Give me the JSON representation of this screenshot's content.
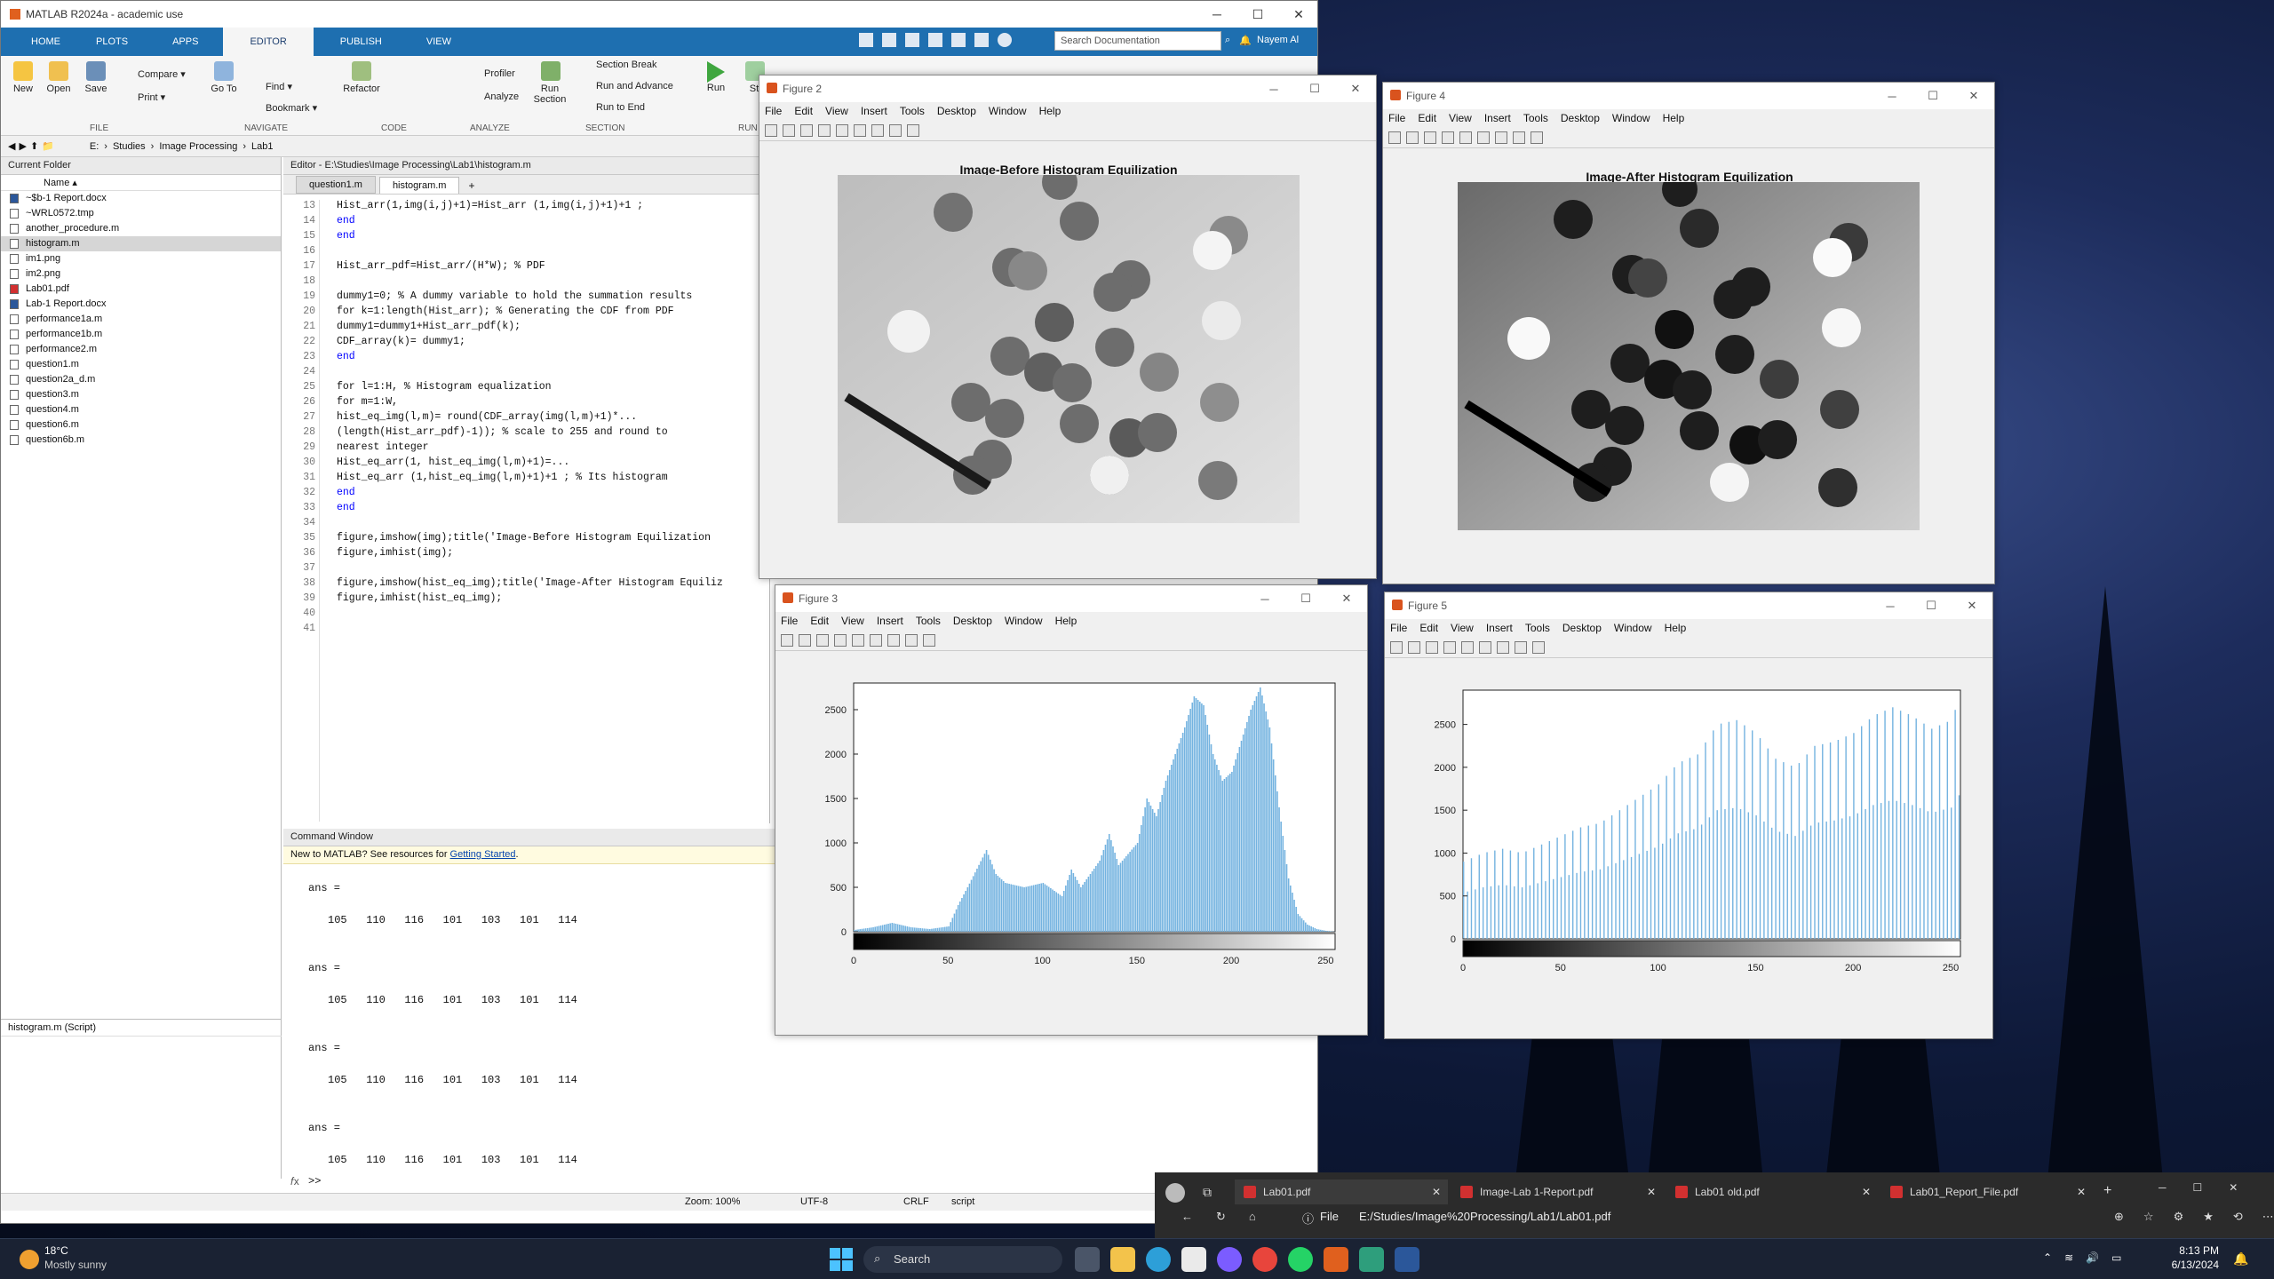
{
  "matlab": {
    "title": "MATLAB R2024a - academic use",
    "tabs": [
      "HOME",
      "PLOTS",
      "APPS",
      "EDITOR",
      "PUBLISH",
      "VIEW"
    ],
    "active_tab": "EDITOR",
    "search_placeholder": "Search Documentation",
    "user": "Nayem Al",
    "ribbon": {
      "new": "New",
      "open": "Open",
      "save": "Save",
      "compare": "Compare",
      "print": "Print",
      "goto": "Go To",
      "find": "Find",
      "bookmark": "Bookmark",
      "refactor": "Refactor",
      "profiler": "Profiler",
      "analyze": "Analyze",
      "run_section": "Run Section",
      "section_break": "Section Break",
      "run_advance": "Run and Advance",
      "run_end": "Run to End",
      "run": "Run",
      "step": "St",
      "groups": {
        "file": "FILE",
        "navigate": "NAVIGATE",
        "code": "CODE",
        "analyze": "ANALYZE",
        "section": "SECTION",
        "run": "RUN"
      }
    },
    "address": [
      "E:",
      "Studies",
      "Image Processing",
      "Lab1"
    ],
    "current_folder": {
      "title": "Current Folder",
      "name_header": "Name",
      "files": [
        "~$b-1 Report.docx",
        "~WRL0572.tmp",
        "another_procedure.m",
        "histogram.m",
        "im1.png",
        "im2.png",
        "Lab01.pdf",
        "Lab-1 Report.docx",
        "performance1a.m",
        "performance1b.m",
        "performance2.m",
        "question1.m",
        "question2a_d.m",
        "question3.m",
        "question4.m",
        "question6.m",
        "question6b.m"
      ],
      "selected": "histogram.m",
      "details": "histogram.m  (Script)"
    },
    "editor": {
      "title": "Editor - E:\\Studies\\Image Processing\\Lab1\\histogram.m",
      "tabs": [
        "question1.m",
        "histogram.m"
      ],
      "lines": [
        {
          "n": "13",
          "t": "Hist_arr(1,img(i,j)+1)=Hist_arr (1,img(i,j)+1)+1 ;"
        },
        {
          "n": "14",
          "t": "end",
          "c": "kw"
        },
        {
          "n": "15",
          "t": "end",
          "c": "kw"
        },
        {
          "n": "16",
          "t": ""
        },
        {
          "n": "17",
          "t": "Hist_arr_pdf=Hist_arr/(H*W); % PDF"
        },
        {
          "n": "18",
          "t": ""
        },
        {
          "n": "19",
          "t": "dummy1=0; % A dummy variable to hold the summation results"
        },
        {
          "n": "20",
          "t": "for k=1:length(Hist_arr); % Generating the CDF from PDF"
        },
        {
          "n": "21",
          "t": "dummy1=dummy1+Hist_arr_pdf(k);"
        },
        {
          "n": "22",
          "t": "CDF_array(k)= dummy1;"
        },
        {
          "n": "23",
          "t": "end",
          "c": "kw"
        },
        {
          "n": "24",
          "t": ""
        },
        {
          "n": "25",
          "t": "for l=1:H, % Histogram equalization"
        },
        {
          "n": "26",
          "t": "for m=1:W,"
        },
        {
          "n": "27",
          "t": "hist_eq_img(l,m)= round(CDF_array(img(l,m)+1)*..."
        },
        {
          "n": "28",
          "t": "(length(Hist_arr_pdf)-1)); % scale to 255 and round to"
        },
        {
          "n": "29",
          "t": "nearest integer"
        },
        {
          "n": "30",
          "t": "Hist_eq_arr(1, hist_eq_img(l,m)+1)=..."
        },
        {
          "n": "31",
          "t": "Hist_eq_arr (1,hist_eq_img(l,m)+1)+1 ; % Its histogram"
        },
        {
          "n": "32",
          "t": "end",
          "c": "kw"
        },
        {
          "n": "33",
          "t": "end",
          "c": "kw"
        },
        {
          "n": "34",
          "t": ""
        },
        {
          "n": "35",
          "t": "figure,imshow(img);title('Image-Before Histogram Equilization"
        },
        {
          "n": "36",
          "t": "figure,imhist(img);"
        },
        {
          "n": "37",
          "t": ""
        },
        {
          "n": "38",
          "t": "figure,imshow(hist_eq_img);title('Image-After Histogram Equiliz"
        },
        {
          "n": "39",
          "t": "figure,imhist(hist_eq_img);"
        },
        {
          "n": "40",
          "t": ""
        },
        {
          "n": "41",
          "t": ""
        }
      ]
    },
    "command_window": {
      "title": "Command Window",
      "banner_prefix": "New to MATLAB? See resources for ",
      "banner_link": "Getting Started",
      "banner_suffix": ".",
      "ans_label": "ans =",
      "ans_values": "105   110   116   101   103   101   114",
      "prompt": ">>"
    },
    "status": {
      "zoom": "Zoom: 100%",
      "encoding": "UTF-8",
      "eol": "CRLF",
      "type": "script"
    }
  },
  "figures": {
    "fig2": {
      "title": "Figure 2",
      "plot_title": "Image-Before Histogram Equilization"
    },
    "fig4": {
      "title": "Figure 4",
      "plot_title": "Image-After Histogram Equilization"
    },
    "fig3": {
      "title": "Figure 3"
    },
    "fig5": {
      "title": "Figure 5"
    },
    "menu": [
      "File",
      "Edit",
      "View",
      "Insert",
      "Tools",
      "Desktop",
      "Window",
      "Help"
    ]
  },
  "chart_data": [
    {
      "type": "bar",
      "title": "",
      "xlim": [
        0,
        255
      ],
      "ylim": [
        0,
        2800
      ],
      "xticks": [
        0,
        50,
        100,
        150,
        200,
        250
      ],
      "yticks": [
        0,
        500,
        1000,
        1500,
        2000,
        2500
      ],
      "color": "#74b3e0",
      "x": [
        0,
        10,
        20,
        30,
        40,
        50,
        55,
        60,
        70,
        75,
        80,
        90,
        100,
        110,
        115,
        120,
        130,
        135,
        140,
        150,
        155,
        160,
        165,
        170,
        175,
        180,
        185,
        190,
        195,
        200,
        205,
        210,
        215,
        220,
        225,
        230,
        235,
        240,
        245,
        250,
        255
      ],
      "values": [
        20,
        50,
        100,
        50,
        30,
        60,
        300,
        500,
        920,
        650,
        550,
        500,
        550,
        400,
        700,
        500,
        800,
        1100,
        750,
        1000,
        1500,
        1300,
        1700,
        2000,
        2300,
        2650,
        2550,
        2000,
        1700,
        1800,
        2150,
        2500,
        2750,
        2300,
        1400,
        600,
        200,
        80,
        30,
        10,
        0
      ]
    },
    {
      "type": "bar",
      "title": "",
      "xlim": [
        0,
        255
      ],
      "ylim": [
        0,
        2900
      ],
      "xticks": [
        0,
        50,
        100,
        150,
        200,
        250
      ],
      "yticks": [
        0,
        500,
        1000,
        1500,
        2000,
        2500
      ],
      "color": "#74b3e0",
      "x": [
        0,
        10,
        20,
        30,
        40,
        50,
        60,
        70,
        80,
        90,
        100,
        110,
        120,
        130,
        140,
        150,
        160,
        170,
        180,
        190,
        200,
        210,
        220,
        230,
        240,
        250,
        255
      ],
      "values": [
        900,
        1000,
        1050,
        1000,
        1100,
        1200,
        1300,
        1350,
        1500,
        1650,
        1800,
        2050,
        2150,
        2500,
        2550,
        2400,
        2100,
        2000,
        2250,
        2300,
        2400,
        2600,
        2700,
        2600,
        2450,
        2550,
        2850
      ]
    }
  ],
  "pdf": {
    "tabs": [
      "Lab01.pdf",
      "Image-Lab 1-Report.pdf",
      "Lab01 old.pdf",
      "Lab01_Report_File.pdf"
    ],
    "file_label": "File",
    "url": "E:/Studies/Image%20Processing/Lab1/Lab01.pdf"
  },
  "taskbar": {
    "weather_temp": "18°C",
    "weather_desc": "Mostly sunny",
    "search": "Search",
    "time": "8:13 PM",
    "date": "6/13/2024"
  }
}
